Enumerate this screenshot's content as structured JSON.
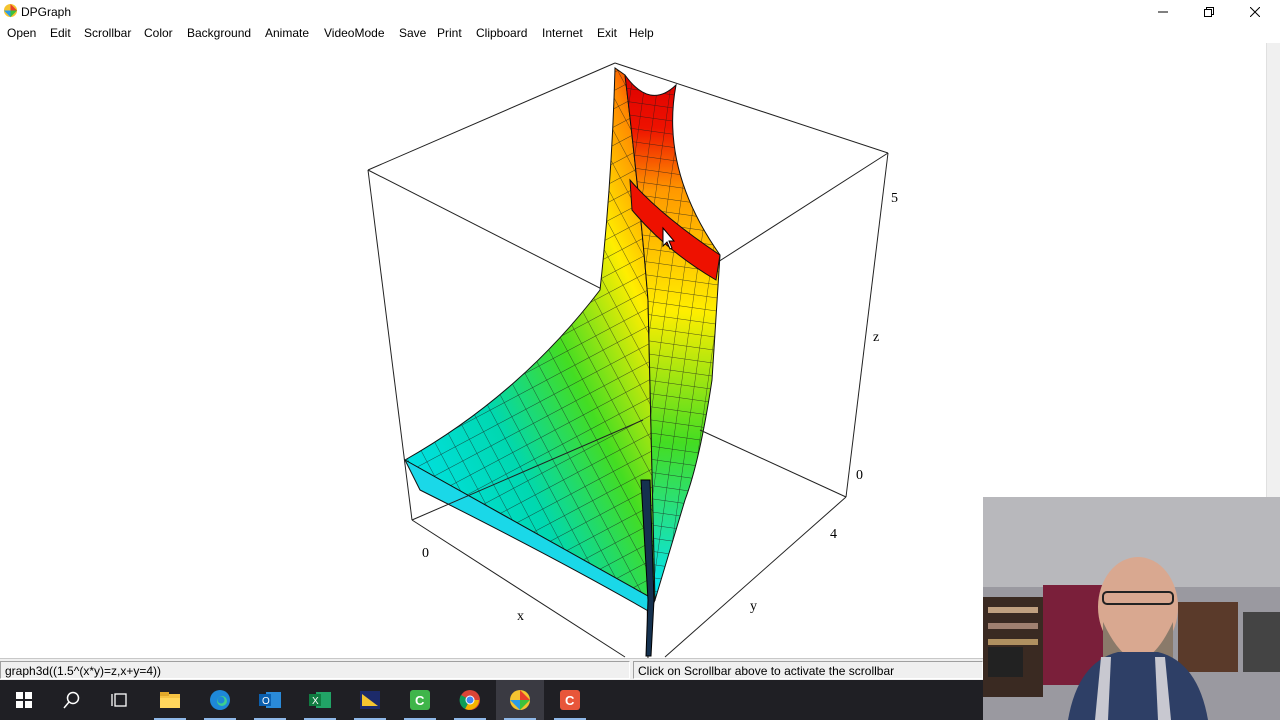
{
  "window": {
    "title": "DPGraph"
  },
  "menu": [
    "Open",
    "Edit",
    "Scrollbar",
    "Color",
    "Background",
    "Animate",
    "VideoMode",
    "Save",
    "Print",
    "Clipboard",
    "Internet",
    "Exit",
    "Help"
  ],
  "graph": {
    "axis_tick_labels": {
      "z_top": "5",
      "z_bottom": "0",
      "y_end": "4",
      "x_start": "0"
    },
    "axis_names": {
      "x": "x",
      "y": "y",
      "z": "z"
    },
    "colors": {
      "low": "#00e5ff",
      "mid": "#33dd22",
      "high": "#ffee00",
      "top": "#ee0000"
    }
  },
  "status": {
    "formula": "graph3d((1.5^(x*y)=z,x+y=4))",
    "hint": "Click on Scrollbar above to activate the scrollbar"
  },
  "taskbar": {
    "items": [
      "start-icon",
      "search-icon",
      "task-view-icon",
      "file-explorer-icon",
      "edge-icon",
      "outlook-icon",
      "excel-icon",
      "app-icon",
      "camtasia-icon",
      "chrome-icon",
      "dpgraph-icon",
      "camtasia-recorder-icon"
    ]
  }
}
